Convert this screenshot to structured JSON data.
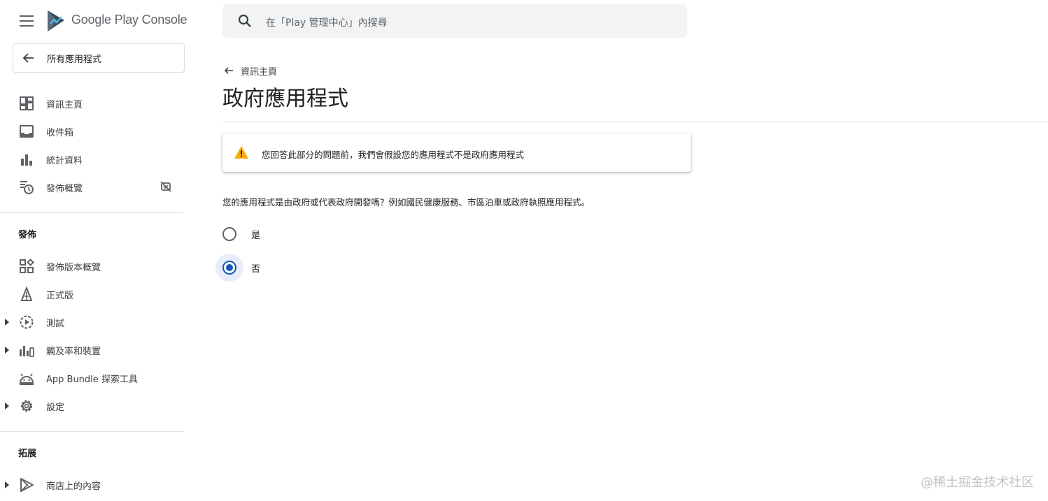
{
  "brand": {
    "name": "Google Play Console"
  },
  "sidebar": {
    "back_label": "所有應用程式",
    "items_top": [
      {
        "label": "資訊主頁",
        "icon": "dashboard-icon"
      },
      {
        "label": "收件箱",
        "icon": "inbox-icon"
      },
      {
        "label": "統計資料",
        "icon": "bar-chart-icon"
      },
      {
        "label": "發佈概覽",
        "icon": "publishing-overview-icon",
        "trailing_icon": "sync-off-icon"
      }
    ],
    "section_release": "發佈",
    "items_release": [
      {
        "label": "發佈版本概覽",
        "icon": "release-overview-icon"
      },
      {
        "label": "正式版",
        "icon": "production-icon"
      },
      {
        "label": "測試",
        "icon": "testing-icon",
        "expandable": true
      },
      {
        "label": "觸及率和裝置",
        "icon": "reach-devices-icon",
        "expandable": true
      },
      {
        "label": "App Bundle 探索工具",
        "icon": "android-icon"
      },
      {
        "label": "設定",
        "icon": "settings-icon",
        "expandable": true
      }
    ],
    "section_grow": "拓展",
    "items_grow": [
      {
        "label": "商店上的內容",
        "icon": "play-store-icon",
        "expandable": true
      }
    ]
  },
  "search": {
    "placeholder": "在「Play 管理中心」內搜尋"
  },
  "main": {
    "back_link": "資訊主頁",
    "title": "政府應用程式",
    "warning": "您回答此部分的問題前，我們會假設您的應用程式不是政府應用程式",
    "question": "您的應用程式是由政府或代表政府開發嗎？例如國民健康服務、市區泊車或政府執照應用程式。",
    "options": [
      {
        "label": "是",
        "selected": false
      },
      {
        "label": "否",
        "selected": true
      }
    ]
  },
  "watermark": "@稀土掘金技术社区",
  "colors": {
    "accent": "#1a57b6",
    "warning": "#f9ab00",
    "search_bg": "#f1f3f4",
    "divider": "#dadce0"
  }
}
